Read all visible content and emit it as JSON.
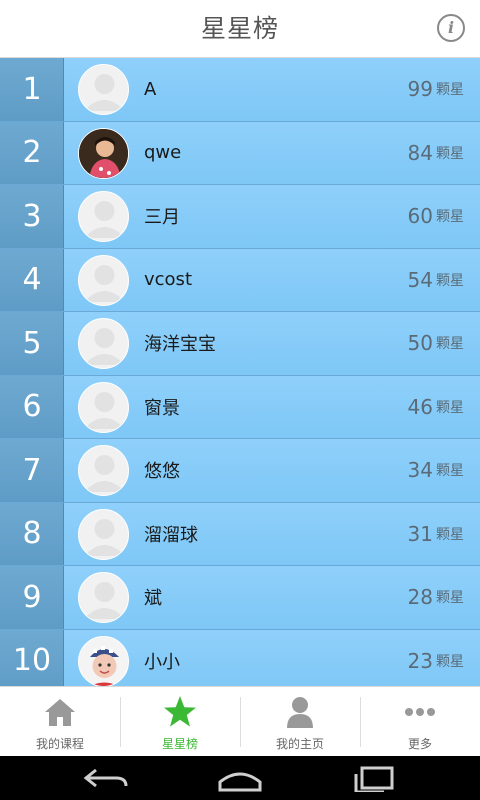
{
  "header": {
    "title": "星星榜",
    "info_icon": "info-icon",
    "info_glyph": "i"
  },
  "ranking": {
    "rows": [
      {
        "rank": "1",
        "name": "A",
        "score": "99",
        "unit": "颗星",
        "avatar": "default-avatar"
      },
      {
        "rank": "2",
        "name": "qwe",
        "score": "84",
        "unit": "颗星",
        "avatar": "photo-avatar-child"
      },
      {
        "rank": "3",
        "name": "三月",
        "score": "60",
        "unit": "颗星",
        "avatar": "default-avatar"
      },
      {
        "rank": "4",
        "name": "vcost",
        "score": "54",
        "unit": "颗星",
        "avatar": "default-avatar"
      },
      {
        "rank": "5",
        "name": "海洋宝宝",
        "score": "50",
        "unit": "颗星",
        "avatar": "default-avatar"
      },
      {
        "rank": "6",
        "name": "窗景",
        "score": "46",
        "unit": "颗星",
        "avatar": "default-avatar"
      },
      {
        "rank": "7",
        "name": "悠悠",
        "score": "34",
        "unit": "颗星",
        "avatar": "default-avatar"
      },
      {
        "rank": "8",
        "name": "溜溜球",
        "score": "31",
        "unit": "颗星",
        "avatar": "default-avatar"
      },
      {
        "rank": "9",
        "name": "斌",
        "score": "28",
        "unit": "颗星",
        "avatar": "default-avatar"
      },
      {
        "rank": "10",
        "name": "小小",
        "score": "23",
        "unit": "颗星",
        "avatar": "photo-avatar-baby"
      }
    ]
  },
  "tabbar": {
    "tabs": [
      {
        "label": "我的课程",
        "icon": "home-icon",
        "active": false
      },
      {
        "label": "星星榜",
        "icon": "star-icon",
        "active": true
      },
      {
        "label": "我的主页",
        "icon": "person-icon",
        "active": false
      },
      {
        "label": "更多",
        "icon": "more-icon",
        "active": false
      }
    ]
  },
  "system_nav": {
    "back_icon": "back-icon",
    "home_icon": "home-nav-icon",
    "recents_icon": "recents-icon"
  },
  "colors": {
    "row_bg": "#86cbf8",
    "rank_bg": "#68a4cd",
    "active_tab": "#3cb934",
    "inactive_icon": "#999999"
  }
}
